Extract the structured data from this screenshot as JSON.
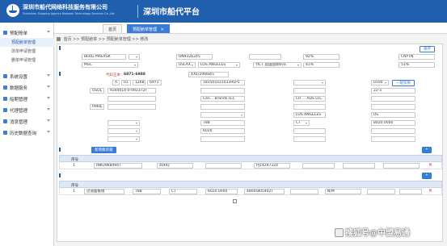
{
  "header": {
    "company": "深圳市船代网络科技服务有限公司",
    "company_en": "Shenzhen Shipping Agency Network Technology Services Co.,Ltd",
    "title": "深圳市船代平台"
  },
  "sidebar": {
    "items": [
      {
        "label": "预配舱单",
        "expanded": true
      },
      {
        "label": "系统设置"
      },
      {
        "label": "数据服务"
      },
      {
        "label": "船期管理"
      },
      {
        "label": "代理管理"
      },
      {
        "label": "消息管理"
      },
      {
        "label": "历史数据查询"
      }
    ],
    "subitems": [
      {
        "label": "预配舱单管理",
        "active": true
      },
      {
        "label": "改单申请管理"
      },
      {
        "label": "删单申请管理"
      }
    ]
  },
  "tabs": [
    {
      "label": "首页"
    },
    {
      "label": "预配舱单管理",
      "active": true
    }
  ],
  "breadcrumb": "首页 >> 预配舱单 >> 预配舱单管理 >> 修改",
  "sections": {
    "basic": "",
    "bill": "",
    "containers": "",
    "goods": ""
  },
  "basic_values": {
    "ship_name": "BERG MAERSK",
    "imo": "UN9326245",
    "voyage": "",
    "operator": "MSC",
    "route_from": "USLAX",
    "route_to": "LOS ANGELES",
    "carrier": "YICT 盐田国际码头",
    "ratio1": "92%",
    "ratio2": "41%",
    "port_code": "CNYTN",
    "flag": "51%",
    "note": "",
    "note2": ""
  },
  "bill_values": {
    "bill_no_label": "代码正本：",
    "bill_no": "6871-6988",
    "sub_no": "XX1/20668/1",
    "code1": "A",
    "code2": "01",
    "code3": "1268",
    "code4": "6971",
    "barcode": "18150102101391P1",
    "notify_ctry": "USOI",
    "consignee_code": "9344014-0-092372F",
    "consignee_name": "Cen... Brands LLC",
    "consignee_name2": "CR ... ADS LLC",
    "shipper_addr": "",
    "port_load": "LOS ANGELES",
    "dest": "US",
    "weight": "6020",
    "gross": "8020.0000",
    "packages": "788",
    "pkg_type": "CT",
    "phone": "22-5",
    "method": "0100",
    "mode_btn": "一般贸易",
    "contact": "0960",
    "voyage_no": "",
    "freight": "",
    "fee": "",
    "remark": ""
  },
  "container_grid": {
    "add_btn": "新增集装箱",
    "headers": [
      "序号",
      "",
      "",
      "",
      "",
      "",
      "",
      ""
    ],
    "rows": [
      {
        "no": "1",
        "box": "INKU9684947",
        "size": "40HQ",
        "weight": "",
        "seal": "PJ14297324",
        "type": "",
        "agent": "",
        "status": ""
      }
    ]
  },
  "goods_grid": {
    "headers": [
      "序号",
      "",
      "",
      "",
      "",
      "",
      "",
      "",
      "",
      ""
    ],
    "rows": [
      {
        "no": "1",
        "desc": "过道面板组",
        "qty": "788",
        "unit": "CT",
        "gross": "6020.0000",
        "volume": "4800(805402)",
        "extra": "N/M"
      }
    ],
    "checkbox_label": ""
  },
  "buttons": {
    "save": "保存",
    "submit": "保存"
  },
  "watermark": "搜狐号@中盟易通",
  "colors": {
    "header": "#1f5fae",
    "accent": "#3a7bd5",
    "label_red": "#c0392b",
    "note_orange": "#e67e22"
  }
}
